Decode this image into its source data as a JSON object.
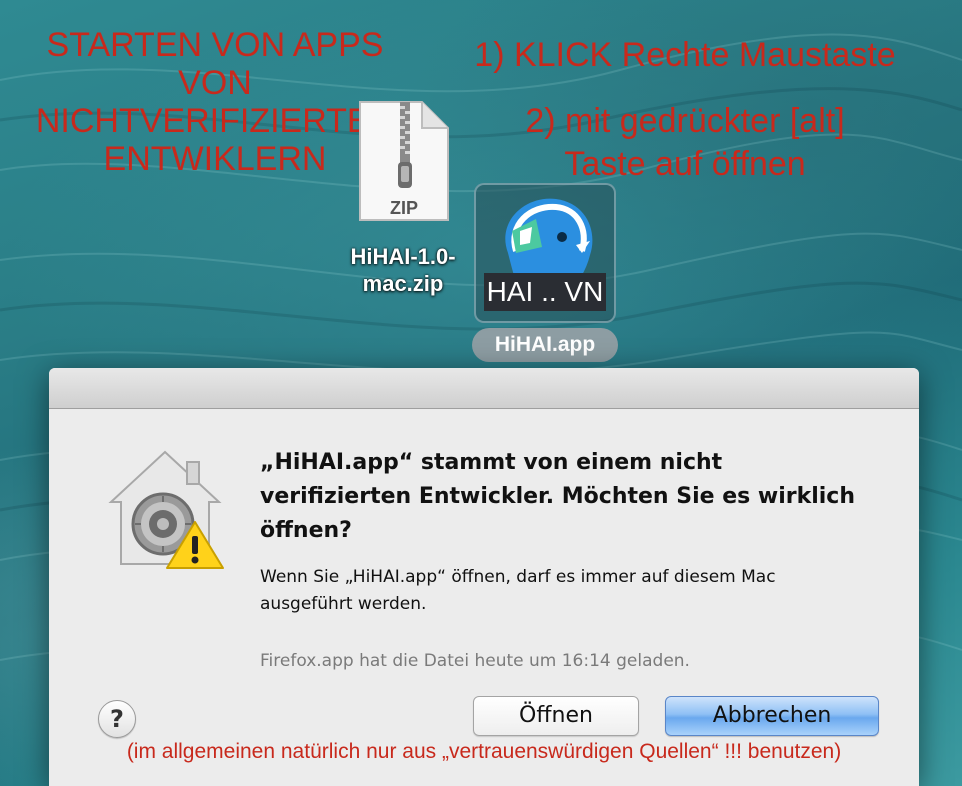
{
  "annotations": {
    "top_left": "STARTEN VON APPS\nVON\nNICHTVERIFIZIERTEN\nENTWIKLERN",
    "step1": "1) KLICK Rechte Maustaste",
    "step2": "2) mit gedrückter [alt]\nTaste auf öffnen",
    "footnote": "(im allgemeinen natürlich nur aus „vertrauenswürdigen Quellen“ !!! benutzen)",
    "color": "#c8291c"
  },
  "desktop": {
    "zip_file": {
      "icon": "zip-file-icon",
      "badge": "ZIP",
      "label": "HiHAI-1.0-\nmac.zip"
    },
    "app_file": {
      "icon": "hihai-app-icon",
      "overlay_text": "HAI .. VN",
      "label": "HiHAI.app"
    }
  },
  "dialog": {
    "icon": "gatekeeper-warning-icon",
    "heading": "„HiHAI.app“ stammt von einem nicht verifizierten Entwickler. Möchten Sie es wirklich öffnen?",
    "body": "Wenn Sie „HiHAI.app“ öffnen, darf es immer auf diesem Mac ausgeführt werden.",
    "source_info": "Firefox.app hat die Datei heute um 16:14 geladen.",
    "help_label": "?",
    "open_button": "Öffnen",
    "cancel_button": "Abbrechen"
  }
}
